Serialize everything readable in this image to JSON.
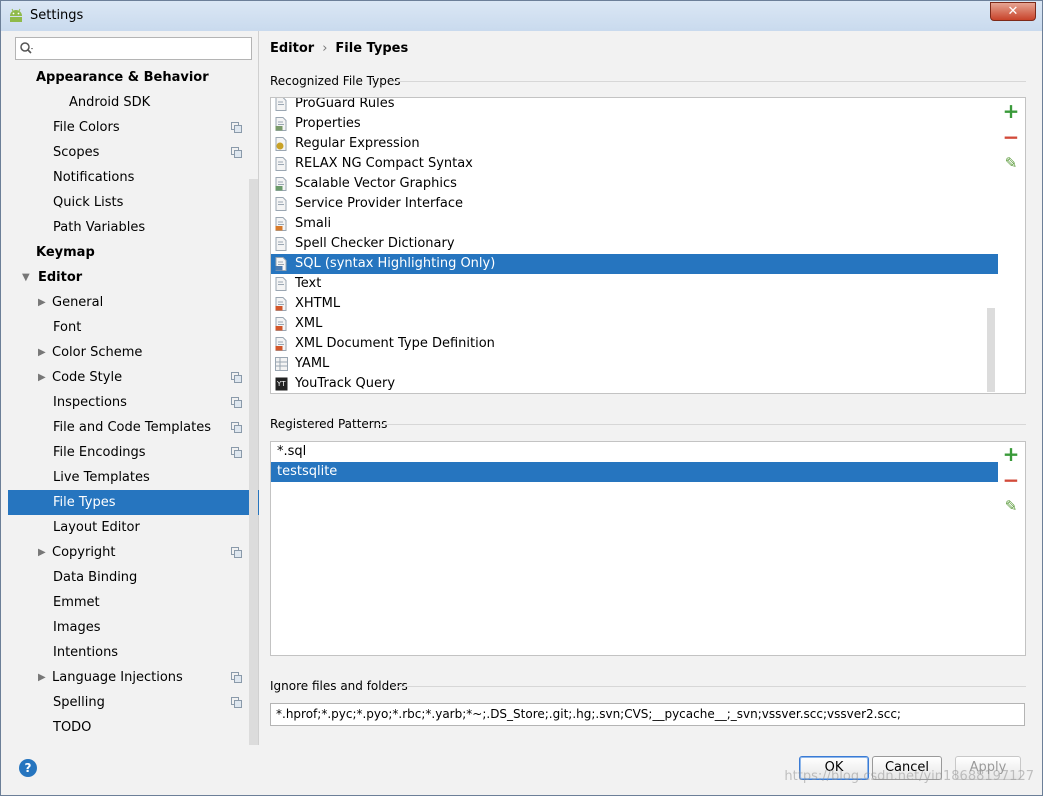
{
  "window": {
    "title": "Settings",
    "close_label": "✕"
  },
  "search": {
    "placeholder": ""
  },
  "tree": {
    "items": [
      {
        "label": "Appearance & Behavior",
        "level": 0,
        "bold": true,
        "arrow": "",
        "copy": false
      },
      {
        "label": "Android SDK",
        "level": 3,
        "bold": false,
        "arrow": "",
        "copy": false
      },
      {
        "label": "File Colors",
        "level": 2,
        "bold": false,
        "arrow": "",
        "copy": true
      },
      {
        "label": "Scopes",
        "level": 2,
        "bold": false,
        "arrow": "",
        "copy": true
      },
      {
        "label": "Notifications",
        "level": 2,
        "bold": false,
        "arrow": "",
        "copy": false
      },
      {
        "label": "Quick Lists",
        "level": 2,
        "bold": false,
        "arrow": "",
        "copy": false
      },
      {
        "label": "Path Variables",
        "level": 2,
        "bold": false,
        "arrow": "",
        "copy": false
      },
      {
        "label": "Keymap",
        "level": 0,
        "bold": true,
        "arrow": "",
        "copy": false
      },
      {
        "label": "Editor",
        "level": 0,
        "bold": true,
        "arrow": "down",
        "copy": false
      },
      {
        "label": "General",
        "level": 1,
        "bold": false,
        "arrow": "right",
        "copy": false
      },
      {
        "label": "Font",
        "level": 2,
        "bold": false,
        "arrow": "",
        "copy": false
      },
      {
        "label": "Color Scheme",
        "level": 1,
        "bold": false,
        "arrow": "right",
        "copy": false
      },
      {
        "label": "Code Style",
        "level": 1,
        "bold": false,
        "arrow": "right",
        "copy": true
      },
      {
        "label": "Inspections",
        "level": 2,
        "bold": false,
        "arrow": "",
        "copy": true
      },
      {
        "label": "File and Code Templates",
        "level": 2,
        "bold": false,
        "arrow": "",
        "copy": true
      },
      {
        "label": "File Encodings",
        "level": 2,
        "bold": false,
        "arrow": "",
        "copy": true
      },
      {
        "label": "Live Templates",
        "level": 2,
        "bold": false,
        "arrow": "",
        "copy": false
      },
      {
        "label": "File Types",
        "level": 2,
        "bold": false,
        "arrow": "",
        "copy": false,
        "selected": true
      },
      {
        "label": "Layout Editor",
        "level": 2,
        "bold": false,
        "arrow": "",
        "copy": false
      },
      {
        "label": "Copyright",
        "level": 1,
        "bold": false,
        "arrow": "right",
        "copy": true
      },
      {
        "label": "Data Binding",
        "level": 2,
        "bold": false,
        "arrow": "",
        "copy": false
      },
      {
        "label": "Emmet",
        "level": 2,
        "bold": false,
        "arrow": "",
        "copy": false
      },
      {
        "label": "Images",
        "level": 2,
        "bold": false,
        "arrow": "",
        "copy": false
      },
      {
        "label": "Intentions",
        "level": 2,
        "bold": false,
        "arrow": "",
        "copy": false
      },
      {
        "label": "Language Injections",
        "level": 1,
        "bold": false,
        "arrow": "right",
        "copy": true
      },
      {
        "label": "Spelling",
        "level": 2,
        "bold": false,
        "arrow": "",
        "copy": true
      },
      {
        "label": "TODO",
        "level": 2,
        "bold": false,
        "arrow": "",
        "copy": false
      }
    ]
  },
  "breadcrumb": {
    "parent": "Editor",
    "separator": "›",
    "current": "File Types"
  },
  "recognized": {
    "label": "Recognized File Types",
    "items": [
      {
        "label": "ProGuard Rules",
        "icon": "doc-lines-icon",
        "color": "#7a8a99"
      },
      {
        "label": "Properties",
        "icon": "properties-icon",
        "color": "#7a9a6a"
      },
      {
        "label": "Regular Expression",
        "icon": "regex-icon",
        "color": "#c9a227"
      },
      {
        "label": "RELAX NG Compact Syntax",
        "icon": "doc-lines-icon",
        "color": "#7a8a99"
      },
      {
        "label": "Scalable Vector Graphics",
        "icon": "svg-file-icon",
        "color": "#6a9a6a"
      },
      {
        "label": "Service Provider Interface",
        "icon": "doc-lines-icon",
        "color": "#7a8a99"
      },
      {
        "label": "Smali",
        "icon": "smali-icon",
        "color": "#d77a2a"
      },
      {
        "label": "Spell Checker Dictionary",
        "icon": "dictionary-icon",
        "color": "#7a8a99"
      },
      {
        "label": "SQL (syntax Highlighting Only)",
        "icon": "sql-icon",
        "color": "#4a7ab0",
        "selected": true
      },
      {
        "label": "Text",
        "icon": "text-file-icon",
        "color": "#8a8a8a"
      },
      {
        "label": "XHTML",
        "icon": "xhtml-icon",
        "color": "#d2562a"
      },
      {
        "label": "XML",
        "icon": "xml-icon",
        "color": "#d2562a"
      },
      {
        "label": "XML Document Type Definition",
        "icon": "dtd-icon",
        "color": "#d2562a"
      },
      {
        "label": "YAML",
        "icon": "yaml-icon",
        "color": "#8a8a8a"
      },
      {
        "label": "YouTrack Query",
        "icon": "youtrack-icon",
        "color": "#222222"
      }
    ]
  },
  "patterns": {
    "label": "Registered Patterns",
    "items": [
      {
        "label": "*.sql"
      },
      {
        "label": "testsqlite",
        "selected": true
      }
    ]
  },
  "tools": {
    "add": "+",
    "remove": "−",
    "edit": "✎"
  },
  "ignore": {
    "label": "Ignore files and folders",
    "value": "*.hprof;*.pyc;*.pyo;*.rbc;*.yarb;*~;.DS_Store;.git;.hg;.svn;CVS;__pycache__;_svn;vssver.scc;vssver2.scc;"
  },
  "buttons": {
    "help": "?",
    "ok": "OK",
    "cancel": "Cancel",
    "apply": "Apply"
  },
  "watermark": "https://blog.csdn.net/yin18688197127"
}
